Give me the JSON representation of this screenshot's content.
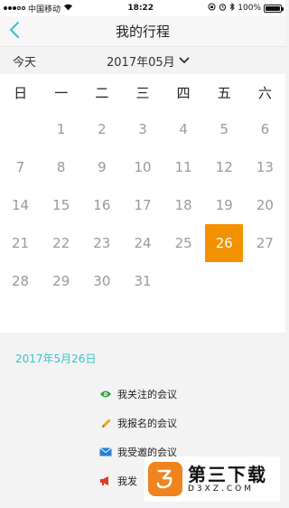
{
  "status_bar": {
    "carrier": "中国移动",
    "time": "18:22",
    "battery": "100%"
  },
  "nav": {
    "title": "我的行程",
    "back_icon": "chevron-left-icon"
  },
  "toolbar": {
    "today_label": "今天",
    "month_label": "2017年05月"
  },
  "calendar": {
    "weekdays": [
      "日",
      "一",
      "二",
      "三",
      "四",
      "五",
      "六"
    ],
    "leading_blanks": 1,
    "days": [
      1,
      2,
      3,
      4,
      5,
      6,
      7,
      8,
      9,
      10,
      11,
      12,
      13,
      14,
      15,
      16,
      17,
      18,
      19,
      20,
      21,
      22,
      23,
      24,
      25,
      26,
      27,
      28,
      29,
      30,
      31
    ],
    "selected_day": 26,
    "selected_color": "#f39200"
  },
  "selected": {
    "date_label": "2017年5月26日",
    "accent": "#35c2cc"
  },
  "meetings": [
    {
      "label": "我关注的会议",
      "icon": "eye-icon",
      "color": "#2aa33b"
    },
    {
      "label": "我报名的会议",
      "icon": "pencil-icon",
      "color": "#e8a31c"
    },
    {
      "label": "我受邀的会议",
      "icon": "envelope-icon",
      "color": "#2a7fd4"
    },
    {
      "label": "我发",
      "icon": "megaphone-icon",
      "color": "#e23a2a"
    }
  ],
  "watermark": {
    "title": "第三下载",
    "subtitle": "D3XZ.COM"
  }
}
